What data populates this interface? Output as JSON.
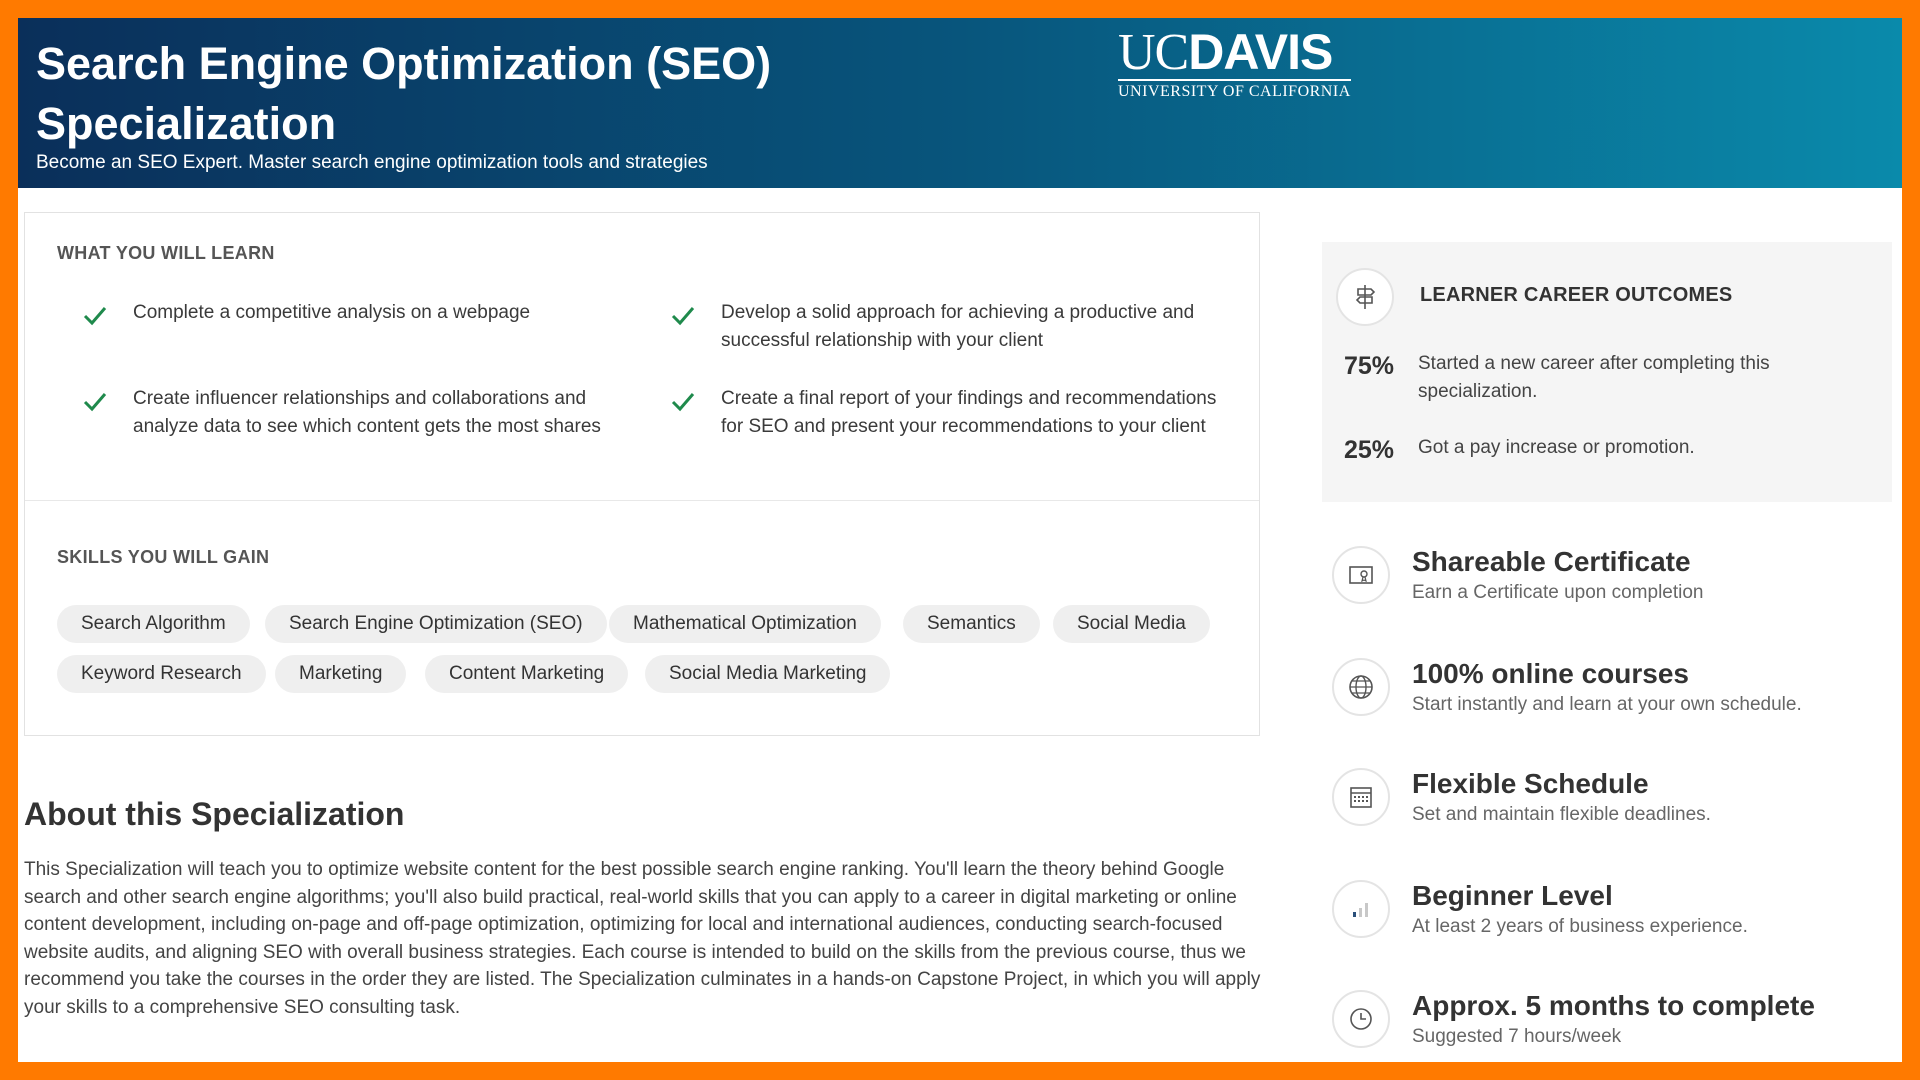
{
  "banner": {
    "title": "Search Engine Optimization (SEO) Specialization",
    "subtitle": "Become an SEO Expert. Master search engine optimization tools and strategies",
    "logo_main_uc": "UC",
    "logo_main_davis": "DAVIS",
    "logo_sub": "UNIVERSITY OF CALIFORNIA"
  },
  "learn": {
    "heading": "WHAT YOU WILL LEARN",
    "items": [
      "Complete a competitive analysis on a webpage",
      "Develop a solid approach for achieving a productive and successful relationship with your client",
      "Create influencer relationships and collaborations and analyze data to see which content gets the most shares",
      "Create a final report of your findings and recommendations for SEO and present your recommendations to your client"
    ]
  },
  "skills": {
    "heading": "SKILLS YOU WILL GAIN",
    "items": [
      "Search Algorithm",
      "Search Engine Optimization (SEO)",
      "Mathematical Optimization",
      "Semantics",
      "Social Media",
      "Keyword Research",
      "Marketing",
      "Content Marketing",
      "Social Media Marketing"
    ]
  },
  "about": {
    "title": "About this Specialization",
    "text": "This Specialization will teach you to optimize website content for the best possible search engine ranking. You'll learn the theory behind Google search and other search engine algorithms; you'll also build practical, real-world skills that you can apply to a career in digital marketing or online content development, including on-page and off-page optimization, optimizing for local and international audiences, conducting search-focused website audits, and aligning SEO with overall business strategies. Each course is intended to build on the skills from the previous course, thus we recommend you take the courses in the order they are listed. The Specialization culminates in a hands-on Capstone Project, in which you will apply your skills to a comprehensive SEO consulting task."
  },
  "outcomes": {
    "heading": "LEARNER CAREER OUTCOMES",
    "stats": [
      {
        "pct": "75%",
        "text": "Started a new career after completing this specialization."
      },
      {
        "pct": "25%",
        "text": "Got a pay increase or promotion."
      }
    ]
  },
  "features": [
    {
      "icon": "certificate-icon",
      "title": "Shareable Certificate",
      "sub": "Earn a Certificate upon completion"
    },
    {
      "icon": "globe-icon",
      "title": "100% online courses",
      "sub": "Start instantly and learn at your own schedule."
    },
    {
      "icon": "calendar-icon",
      "title": "Flexible Schedule",
      "sub": "Set and maintain flexible deadlines."
    },
    {
      "icon": "level-bars-icon",
      "title": "Beginner Level",
      "sub": "At least 2 years of business experience."
    },
    {
      "icon": "clock-icon",
      "title": "Approx. 5 months to complete",
      "sub": "Suggested 7 hours/week"
    }
  ],
  "colors": {
    "frame": "#ff7a00",
    "banner_start": "#0a2f5a",
    "banner_end": "#0a8aab",
    "check": "#1f8a4c"
  }
}
